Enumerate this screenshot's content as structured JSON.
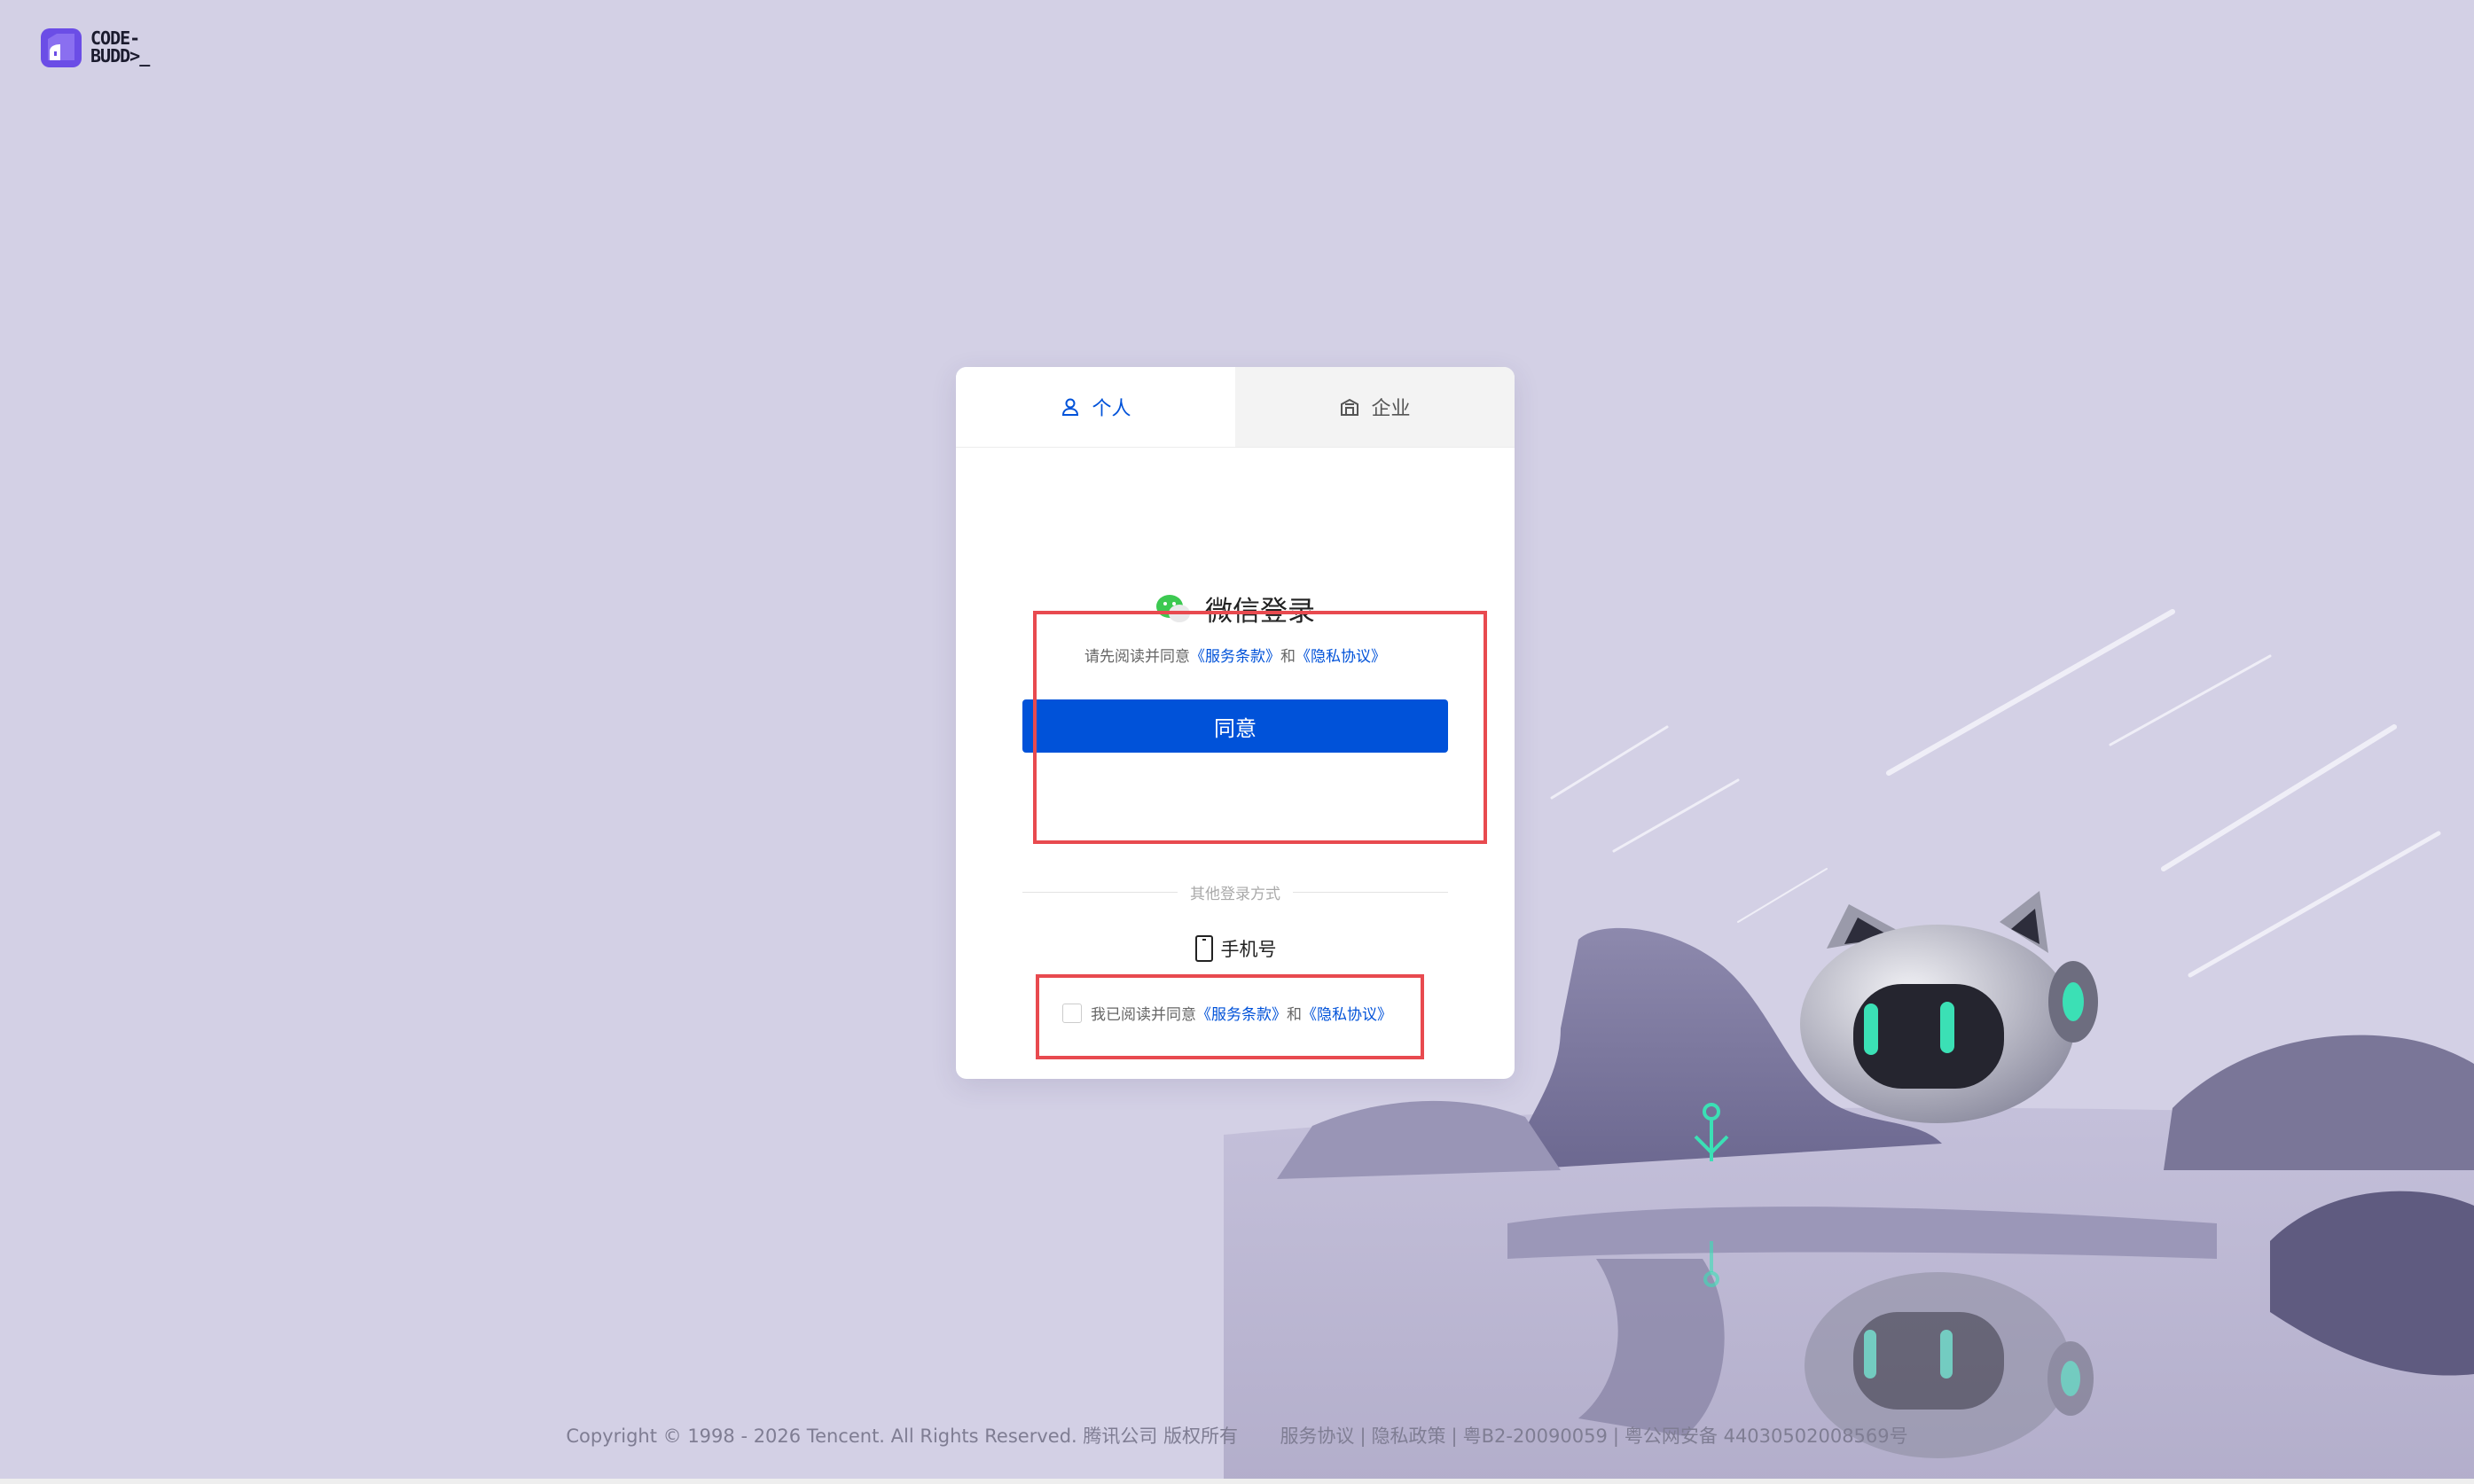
{
  "logo": {
    "line1": "CODE-",
    "line2": "BUDD>_"
  },
  "tabs": [
    {
      "label": "个人",
      "icon": "user-icon",
      "active": true
    },
    {
      "label": "企业",
      "icon": "building-icon",
      "active": false
    }
  ],
  "wechat": {
    "title": "微信登录",
    "agree_prefix": "请先阅读并同意",
    "terms_link": "《服务条款》",
    "and": "和",
    "privacy_link": "《隐私协议》",
    "agree_button": "同意"
  },
  "other_login": {
    "divider_label": "其他登录方式",
    "phone_label": "手机号"
  },
  "consent": {
    "prefix": "我已阅读并同意",
    "terms_link": "《服务条款》",
    "and": "和",
    "privacy_link": "《隐私协议》",
    "checked": false
  },
  "footer": {
    "copyright": "Copyright © 1998 - 2026 Tencent. All Rights Reserved. 腾讯公司 版权所有",
    "service_agreement": "服务协议",
    "privacy_policy": "隐私政策",
    "icp": "粤B2-20090059",
    "police": "粤公网安备 44030502008569号"
  },
  "colors": {
    "background": "#d3d0e5",
    "primary": "#0052d9",
    "highlight": "#e84a4f",
    "robot_eye": "#3be0b5"
  }
}
